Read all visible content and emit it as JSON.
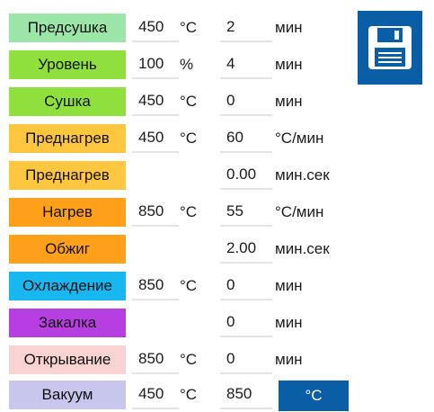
{
  "save_button": {
    "icon": "floppy-disk-icon",
    "color": "#0a5ea6"
  },
  "rows": [
    {
      "label": "Предсушка",
      "color": "#9be5a8",
      "temp": "450",
      "temp_unit": "°C",
      "value": "2",
      "value_unit": "мин"
    },
    {
      "label": "Уровень",
      "color": "#8fe03c",
      "temp": "100",
      "temp_unit": "%",
      "value": "4",
      "value_unit": "мин"
    },
    {
      "label": "Сушка",
      "color": "#8fe03c",
      "temp": "450",
      "temp_unit": "°C",
      "value": "0",
      "value_unit": "мин"
    },
    {
      "label": "Преднагрев",
      "color": "#ffc640",
      "temp": "450",
      "temp_unit": "°C",
      "value": "60",
      "value_unit": "°С/мин"
    },
    {
      "label": "Преднагрев",
      "color": "#ffc640",
      "temp": "",
      "temp_unit": "",
      "value": "0.00",
      "value_unit": "мин.сек"
    },
    {
      "label": "Нагрев",
      "color": "#ffa01a",
      "temp": "850",
      "temp_unit": "°C",
      "value": "55",
      "value_unit": "°С/мин"
    },
    {
      "label": "Обжиг",
      "color": "#ffa01a",
      "temp": "",
      "temp_unit": "",
      "value": "2.00",
      "value_unit": "мин.сек"
    },
    {
      "label": "Охлаждение",
      "color": "#17b7f0",
      "temp": "850",
      "temp_unit": "°C",
      "value": "0",
      "value_unit": "мин"
    },
    {
      "label": "Закалка",
      "color": "#b73ee0",
      "temp": "",
      "temp_unit": "",
      "value": "0",
      "value_unit": "мин"
    },
    {
      "label": "Открывание",
      "color": "#f9d2d2",
      "temp": "850",
      "temp_unit": "°C",
      "value": "0",
      "value_unit": "мин"
    },
    {
      "label": "Вакуум",
      "color": "#c9c6ee",
      "temp": "450",
      "temp_unit": "°C",
      "value": "850",
      "value_unit": ""
    }
  ],
  "unit_button": {
    "label": "°C",
    "color": "#0a5ea6"
  }
}
